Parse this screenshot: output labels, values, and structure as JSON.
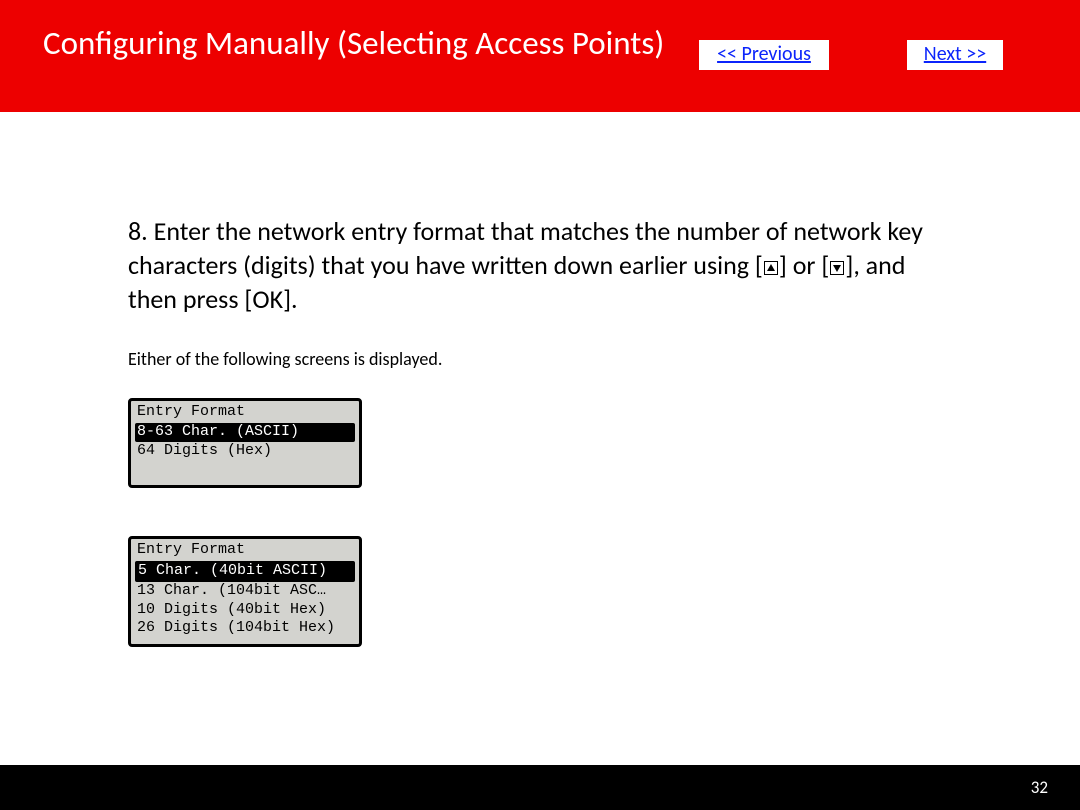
{
  "header": {
    "title": "Configuring Manually (Selecting Access Points)",
    "prev_label": "<< Previous",
    "next_label": "Next >>"
  },
  "instruction": {
    "lead": "8. Enter the network entry format that matches the number of network key characters (digits) that you have written down earlier using [",
    "mid": "] or [",
    "tail": "], and then press [OK]."
  },
  "subnote": "Either of the following screens is displayed.",
  "lcd1": {
    "title": "Entry Format",
    "rows": [
      {
        "text": "8-63 Char. (ASCII)",
        "selected": true
      },
      {
        "text": "64 Digits (Hex)",
        "selected": false
      }
    ]
  },
  "lcd2": {
    "title": "Entry Format",
    "rows": [
      {
        "text": "5 Char. (40bit ASCII)",
        "selected": true
      },
      {
        "text": "13 Char. (104bit ASC…",
        "selected": false
      },
      {
        "text": "10 Digits (40bit Hex)",
        "selected": false
      },
      {
        "text": "26 Digits (104bit Hex)",
        "selected": false
      }
    ]
  },
  "page_number": "32"
}
